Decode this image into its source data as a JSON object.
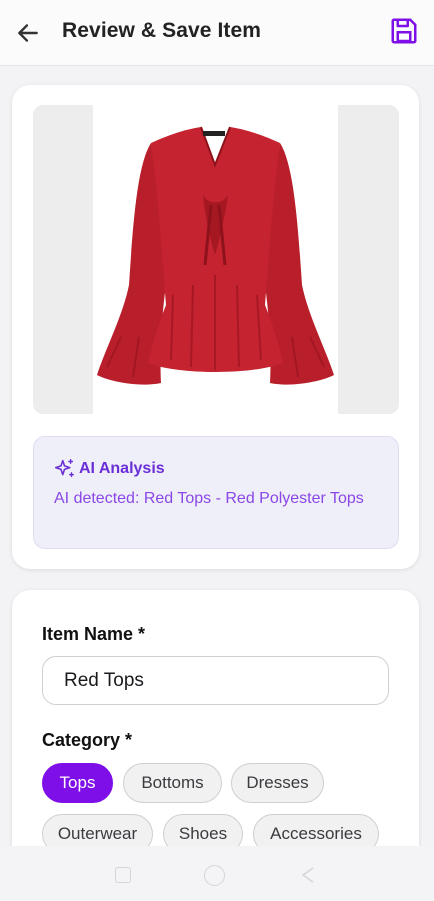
{
  "header": {
    "title": "Review & Save Item",
    "back_icon": "arrow-left-icon",
    "save_icon": "floppy-disk-icon",
    "accent_color": "#7e0fe8"
  },
  "image_card": {
    "image_description_icon": "red-tops-photo",
    "ai_analysis": {
      "icon": "sparkles-icon",
      "title": "AI Analysis",
      "text": "AI detected: Red Tops - Red Polyester Tops"
    }
  },
  "form": {
    "item_name_label": "Item Name *",
    "item_name_value": "Red Tops",
    "category_label": "Category *",
    "categories": [
      {
        "label": "Tops",
        "selected": true
      },
      {
        "label": "Bottoms",
        "selected": false
      },
      {
        "label": "Dresses",
        "selected": false
      },
      {
        "label": "Outerwear",
        "selected": false
      },
      {
        "label": "Shoes",
        "selected": false
      },
      {
        "label": "Accessories",
        "selected": false
      }
    ]
  },
  "system_nav": {
    "icons": [
      "recent-apps-icon",
      "home-icon",
      "back-triangle-icon"
    ]
  }
}
